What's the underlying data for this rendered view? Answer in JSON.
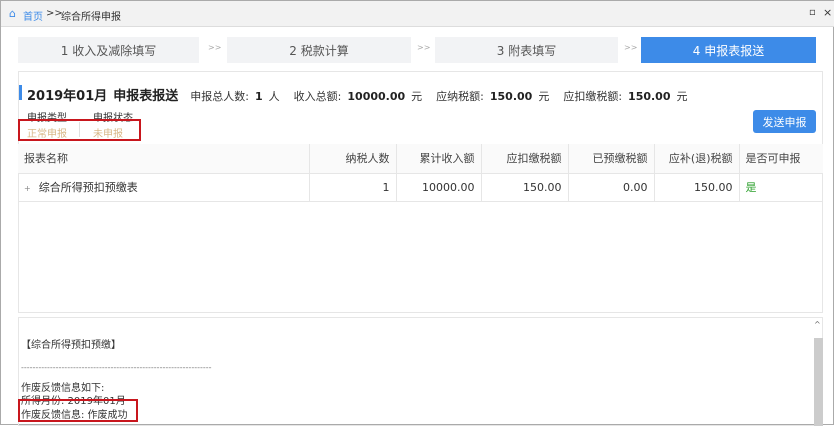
{
  "breadcrumb": {
    "home": "首页",
    "sep": ">>",
    "current": "综合所得申报"
  },
  "window_controls": {
    "restore": "▫",
    "close": "×"
  },
  "steps": [
    {
      "label": "1 收入及减除填写"
    },
    {
      "label": "2 税款计算"
    },
    {
      "label": "3 附表填写"
    },
    {
      "label": "4 申报表报送",
      "active": true
    }
  ],
  "step_sep": ">>",
  "summary": {
    "period": "2019年01月",
    "title": "申报表报送",
    "people_label": "申报总人数:",
    "people": "1",
    "people_unit": "人",
    "income_label": "收入总额:",
    "income": "10000.00",
    "income_unit": "元",
    "tax_label": "应纳税额:",
    "tax": "150.00",
    "tax_unit": "元",
    "withhold_label": "应扣缴税额:",
    "withhold": "150.00",
    "withhold_unit": "元"
  },
  "filing": {
    "type_label": "申报类型",
    "status_label": "申报状态",
    "type": "正常申报",
    "status": "未申报"
  },
  "send_button": "发送申报",
  "table": {
    "headers": [
      "报表名称",
      "纳税人数",
      "累计收入额",
      "应扣缴税额",
      "已预缴税额",
      "应补(退)税额",
      "是否可申报"
    ],
    "rows": [
      [
        "综合所得预扣预缴表",
        "1",
        "10000.00",
        "150.00",
        "0.00",
        "150.00",
        "是"
      ]
    ]
  },
  "log": {
    "section": "【综合所得预扣预缴】",
    "divider": "------------------------------------------------------------------",
    "l1": "作废反馈信息如下:",
    "l2": "所得月份: 2019年01月",
    "l3": "作废反馈信息: 作废成功"
  },
  "colors": {
    "accent": "#3d8be8",
    "highlight": "#c8161d",
    "yes": "#2ca02c"
  }
}
